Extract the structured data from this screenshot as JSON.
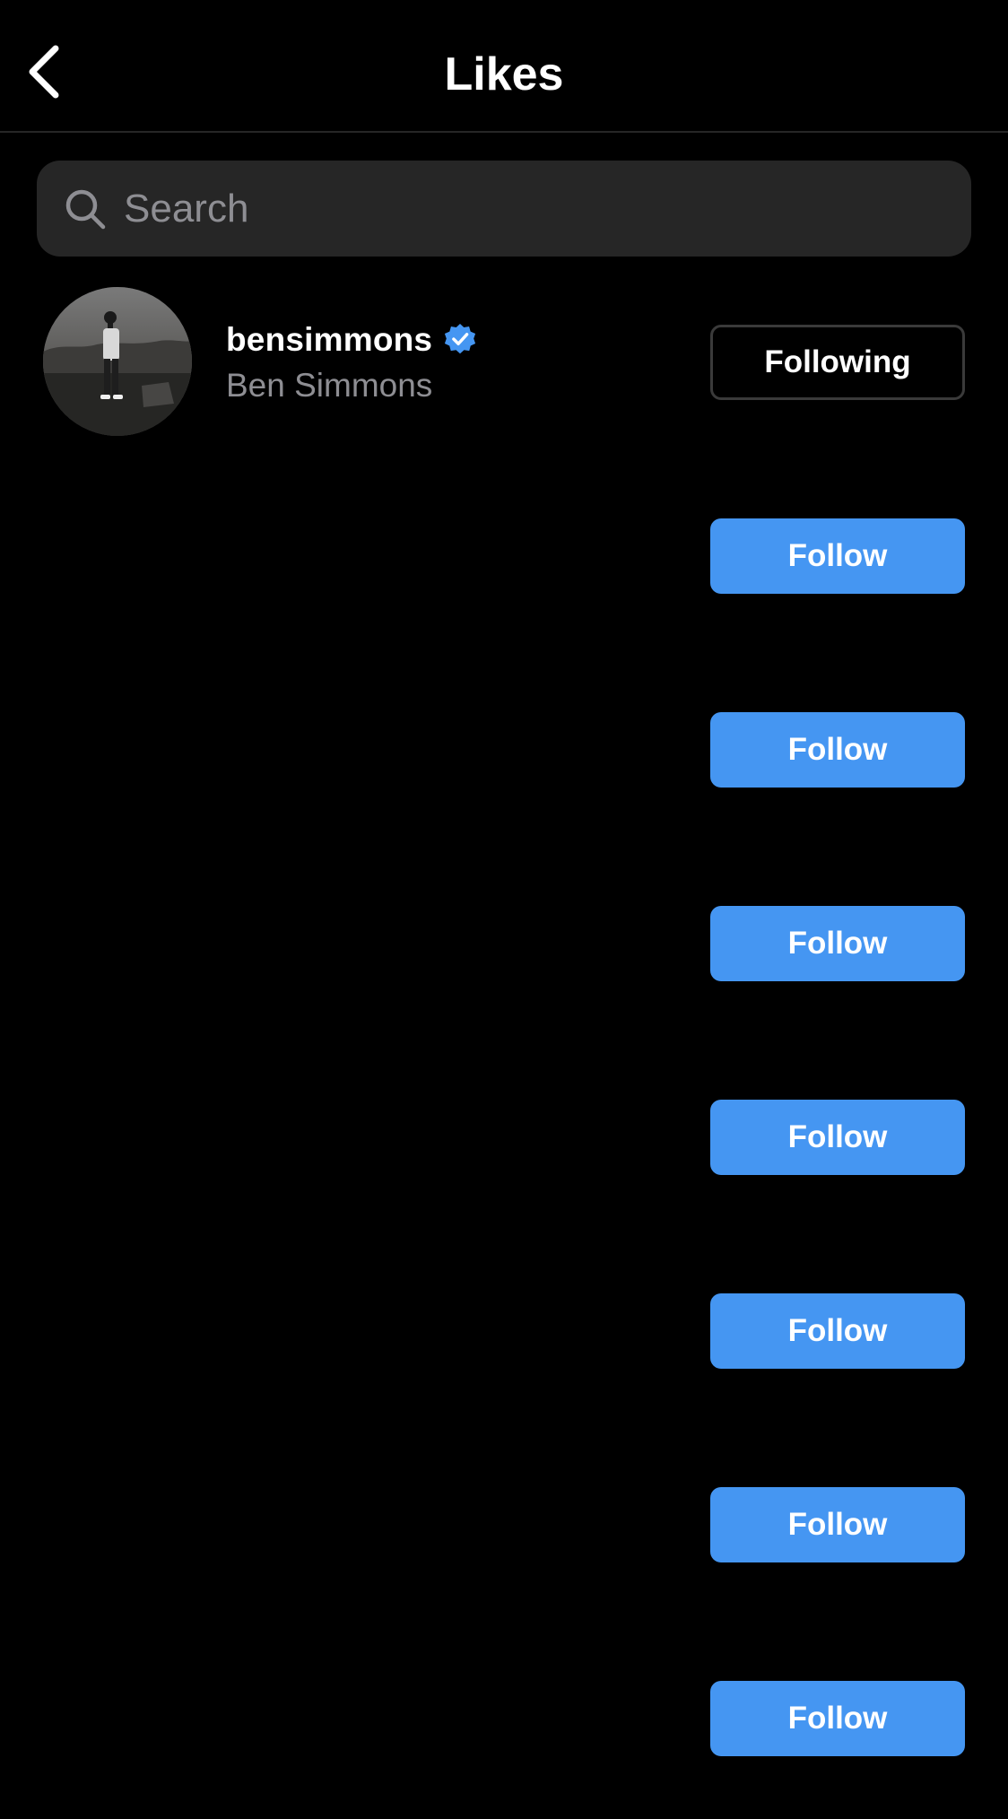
{
  "header": {
    "title": "Likes",
    "back_icon": "chevron-left-icon"
  },
  "search": {
    "placeholder": "Search",
    "icon": "search-icon"
  },
  "colors": {
    "background": "#000000",
    "search_bg": "#262626",
    "follow_button": "#4596f2",
    "verified_badge": "#4596f2",
    "secondary_text": "#8e8e93"
  },
  "likers": [
    {
      "username": "bensimmons",
      "full_name": "Ben Simmons",
      "verified": true,
      "button_label": "Following",
      "state": "following"
    },
    {
      "username": "",
      "full_name": "",
      "verified": false,
      "button_label": "Follow",
      "state": "follow"
    },
    {
      "username": "",
      "full_name": "",
      "verified": false,
      "button_label": "Follow",
      "state": "follow"
    },
    {
      "username": "",
      "full_name": "",
      "verified": false,
      "button_label": "Follow",
      "state": "follow"
    },
    {
      "username": "",
      "full_name": "",
      "verified": false,
      "button_label": "Follow",
      "state": "follow"
    },
    {
      "username": "",
      "full_name": "",
      "verified": false,
      "button_label": "Follow",
      "state": "follow"
    },
    {
      "username": "",
      "full_name": "",
      "verified": false,
      "button_label": "Follow",
      "state": "follow"
    },
    {
      "username": "",
      "full_name": "",
      "verified": false,
      "button_label": "Follow",
      "state": "follow"
    }
  ]
}
